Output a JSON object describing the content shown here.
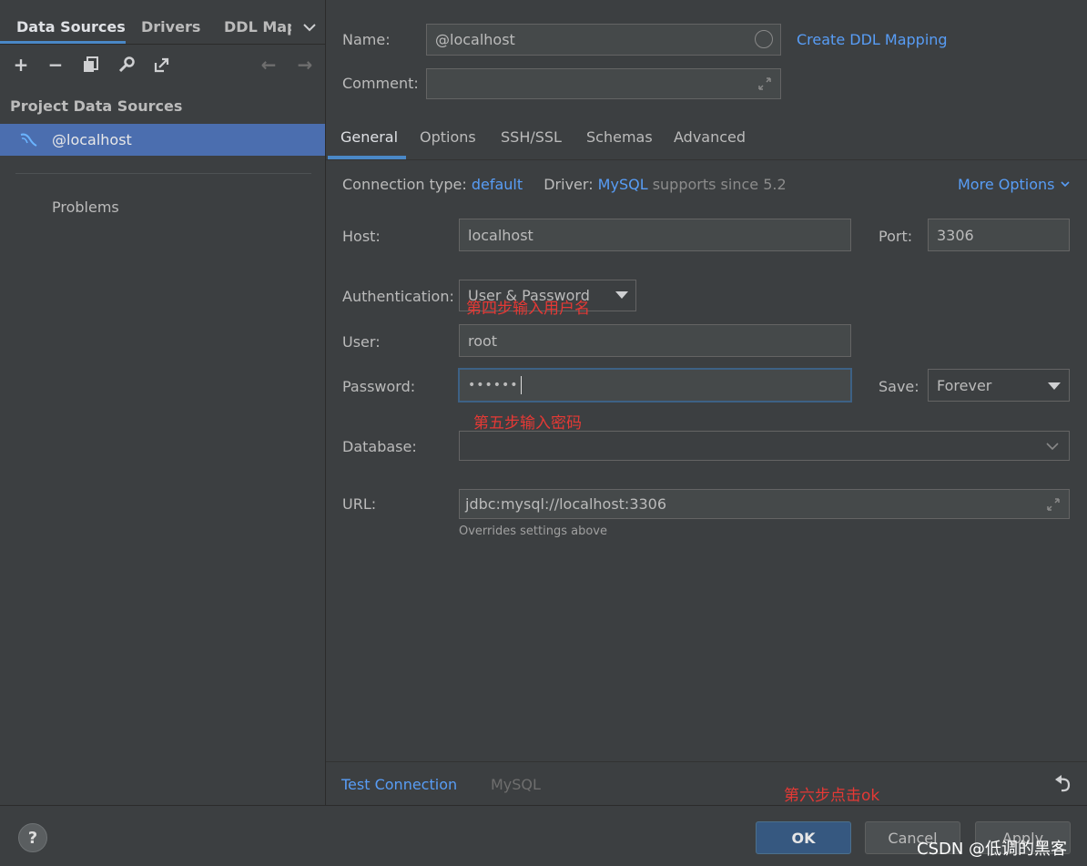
{
  "left": {
    "tabs": [
      "Data Sources",
      "Drivers",
      "DDL Map"
    ],
    "section_title": "Project Data Sources",
    "selected_source": "@localhost",
    "problems": "Problems"
  },
  "header": {
    "name_label": "Name:",
    "name_value": "@localhost",
    "create_ddl_link": "Create DDL Mapping",
    "comment_label": "Comment:"
  },
  "subtabs": [
    "General",
    "Options",
    "SSH/SSL",
    "Schemas",
    "Advanced"
  ],
  "general": {
    "conn_type_label": "Connection type:",
    "conn_type_value": "default",
    "driver_label": "Driver:",
    "driver_value": "MySQL",
    "driver_note": "supports since 5.2",
    "more_options": "More Options",
    "host_label": "Host:",
    "host_value": "localhost",
    "port_label": "Port:",
    "port_value": "3306",
    "auth_label": "Authentication:",
    "auth_value": "User & Password",
    "user_label": "User:",
    "user_value": "root",
    "password_label": "Password:",
    "password_value": "••••••",
    "save_label": "Save:",
    "save_value": "Forever",
    "database_label": "Database:",
    "url_label": "URL:",
    "url_value": "jdbc:mysql://localhost:3306",
    "url_hint": "Overrides settings above"
  },
  "annotations": {
    "step4": "第四步输入用户名",
    "step5": "第五步输入密码",
    "step6": "第六步点击ok"
  },
  "bottom": {
    "test_connection": "Test Connection",
    "mysql": "MySQL",
    "ok": "OK",
    "cancel": "Cancel",
    "apply": "Apply",
    "help": "?"
  },
  "watermark": "CSDN @低调的黑客",
  "colors": {
    "accent": "#589df6",
    "selection": "#4b6eaf",
    "annotation": "#e53935"
  }
}
